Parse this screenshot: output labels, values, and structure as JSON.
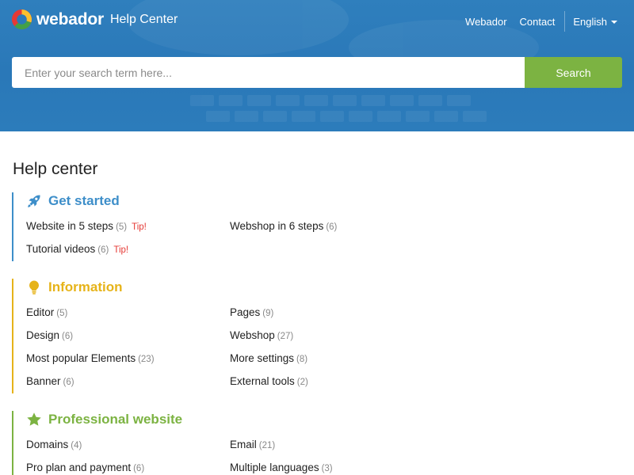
{
  "header": {
    "brand": "webador",
    "subtitle": "Help Center",
    "nav": [
      {
        "label": "Webador"
      },
      {
        "label": "Contact"
      }
    ],
    "language": "English",
    "search": {
      "placeholder": "Enter your search term here...",
      "button_label": "Search"
    }
  },
  "main": {
    "title": "Help center",
    "sections": [
      {
        "title": "Get started",
        "icon": "rocket-icon",
        "color": "#3d8ec9",
        "items": [
          {
            "label": "Website in 5 steps",
            "count": "(5)",
            "tip": "Tip!"
          },
          {
            "label": "Webshop in 6 steps",
            "count": "(6)"
          },
          {
            "label": "Tutorial videos",
            "count": "(6)",
            "tip": "Tip!"
          }
        ]
      },
      {
        "title": "Information",
        "icon": "lightbulb-icon",
        "color": "#e6b319",
        "items": [
          {
            "label": "Editor",
            "count": "(5)"
          },
          {
            "label": "Pages",
            "count": "(9)"
          },
          {
            "label": "Design",
            "count": "(6)"
          },
          {
            "label": "Webshop",
            "count": "(27)"
          },
          {
            "label": "Most popular Elements",
            "count": "(23)"
          },
          {
            "label": "More settings",
            "count": "(8)"
          },
          {
            "label": "Banner",
            "count": "(6)"
          },
          {
            "label": "External tools",
            "count": "(2)"
          }
        ]
      },
      {
        "title": "Professional website",
        "icon": "star-icon",
        "color": "#7cb342",
        "items": [
          {
            "label": "Domains",
            "count": "(4)"
          },
          {
            "label": "Email",
            "count": "(21)"
          },
          {
            "label": "Pro plan and payment",
            "count": "(6)"
          },
          {
            "label": "Multiple languages",
            "count": "(3)"
          }
        ]
      }
    ]
  }
}
